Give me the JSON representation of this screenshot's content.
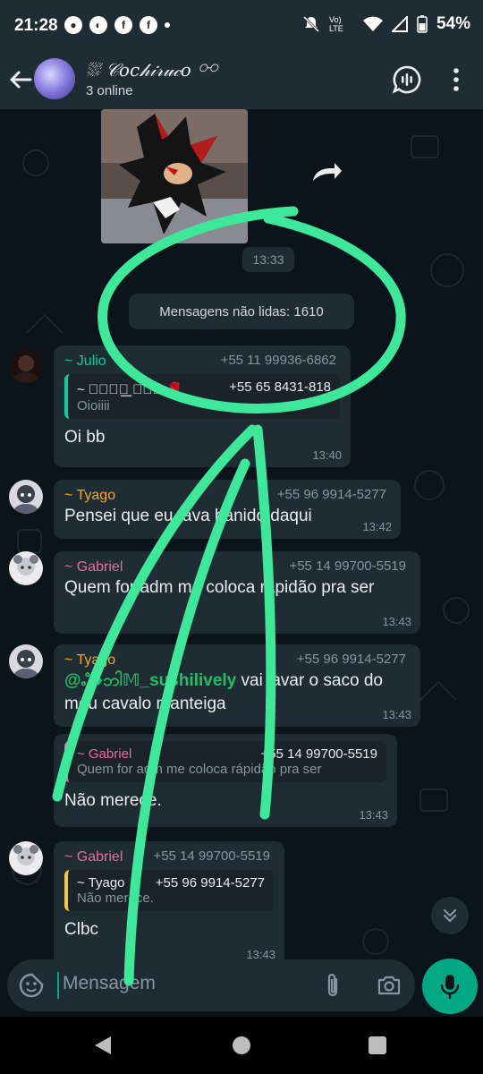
{
  "status_bar": {
    "time": "21:28",
    "battery": "54%",
    "network": "Vo) LTE"
  },
  "header": {
    "group_name": "⛆ 𝒞𝑜𝑐𝒽𝒾𝓇𝓊𝒸𝑜 ⚯",
    "subtitle": "3 online"
  },
  "chat": {
    "image_time": "13:33",
    "unread_banner": "Mensagens não lidas: 1610",
    "messages": [
      {
        "sender": "~ Julio",
        "phone": "+55 11 99936-6862",
        "quote_sender": "~ ⥹꯭𝒩𝒾 ꯭⟡꯭⟢ 🌹",
        "quote_phone": "+55 65 8431-818",
        "quote_text": "Oioiiii",
        "text": "Oi bb",
        "time": "13:40"
      },
      {
        "sender": "~ Tyago",
        "phone": "+55 96 9914-5277",
        "text": "Pensei que eu tava banido daqui",
        "time": "13:42"
      },
      {
        "sender": "~ Gabriel",
        "phone": "+55 14 99700-5519",
        "text": "Quem for adm me coloca rápidão pra ser",
        "time": "13:43"
      },
      {
        "sender": "~ Tyago",
        "phone": "+55 96 9914-5277",
        "mention": "@ஃ♦ဘါ𝕄_sushilively",
        "text": " vai lavar o saco do meu cavalo manteiga",
        "time": "13:43"
      },
      {
        "quote_sender": "~ Gabriel",
        "quote_phone": "+55 14 99700-5519",
        "quote_text": "Quem for adm me coloca rápidão pra ser",
        "text": "Não merece.",
        "time": "13:43"
      },
      {
        "sender": "~ Gabriel",
        "phone": "+55 14 99700-5519",
        "quote_sender": "~ Tyago",
        "quote_phone": "+55 96 9914-5277",
        "quote_text": "Não merece.",
        "text": "Clbc",
        "time": "13:43"
      }
    ]
  },
  "input": {
    "placeholder": "Mensagem"
  },
  "colors": {
    "accent": "#00a884",
    "annotation": "#3ee89a",
    "sender_julio": "#06cf9c",
    "sender_tyago": "#f5a623",
    "sender_gabriel": "#e86aa0",
    "mention": "#21c063"
  }
}
